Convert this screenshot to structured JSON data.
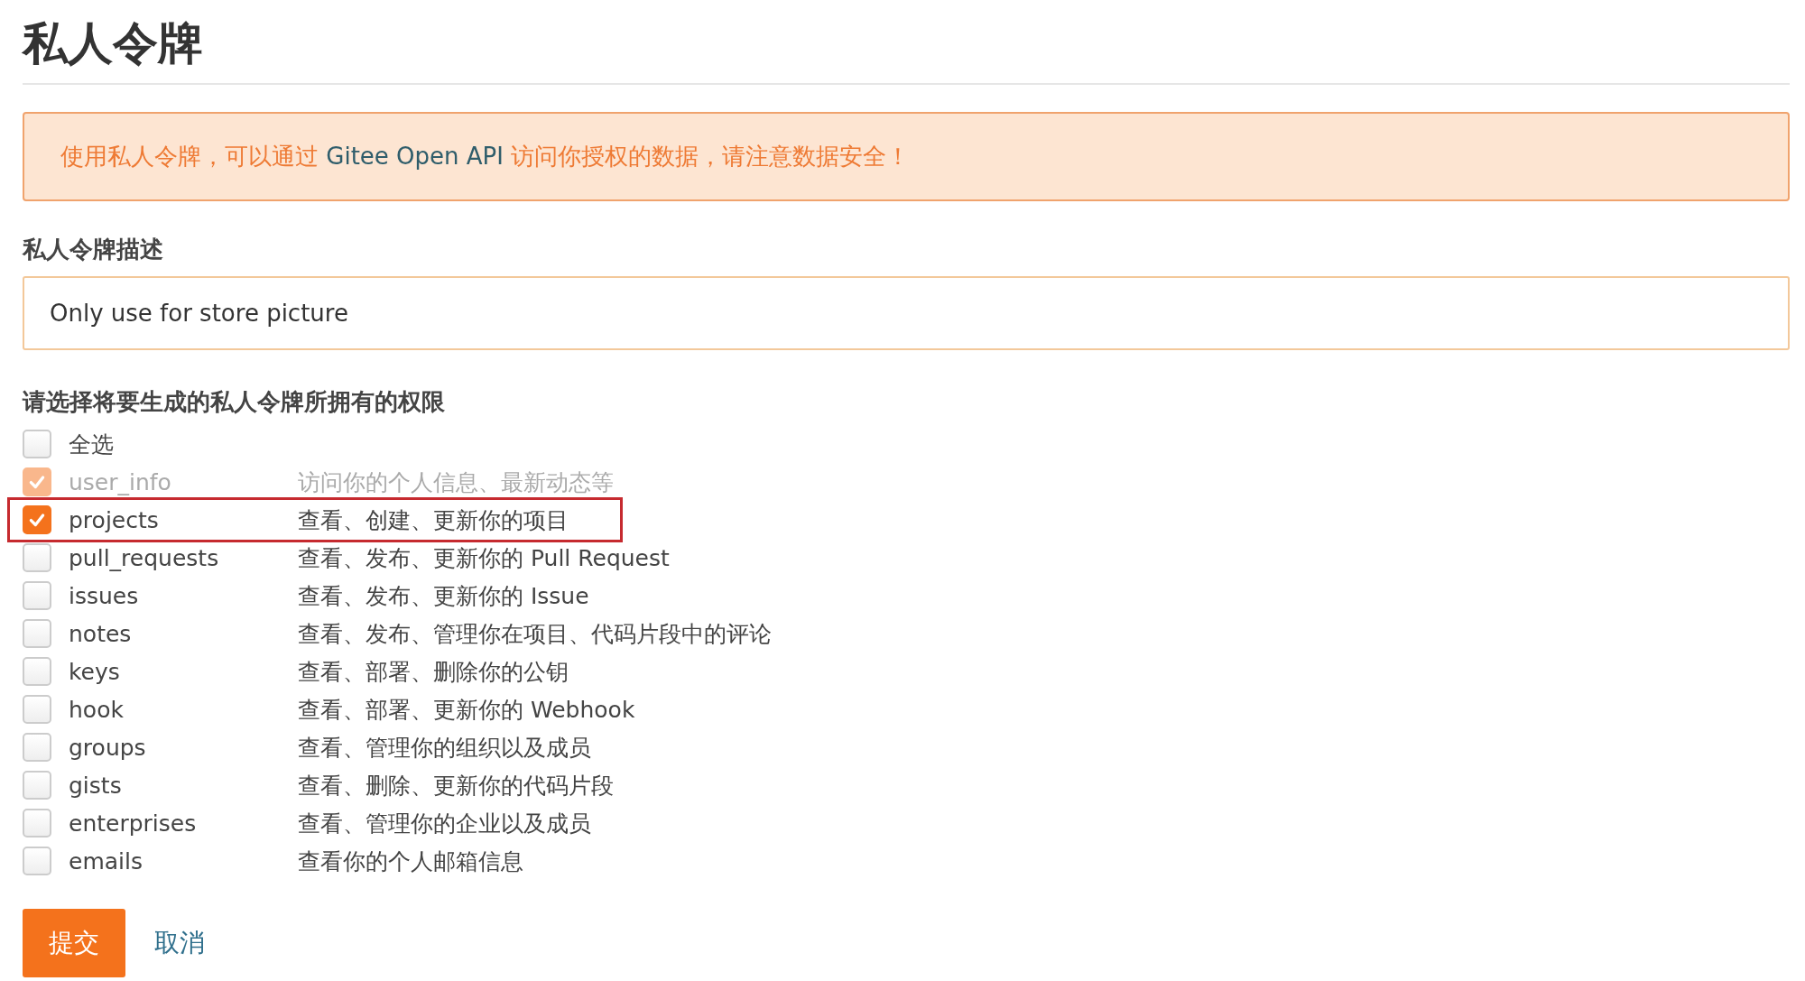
{
  "title": "私人令牌",
  "alert": {
    "segments": [
      {
        "kind": "plain",
        "text": "使用私人令牌，可以通过 "
      },
      {
        "kind": "term",
        "text": "Gitee Open API"
      },
      {
        "kind": "plain",
        "text": " 访问你授权的数据，请注意数据安全！"
      }
    ]
  },
  "description_field": {
    "label": "私人令牌描述",
    "value": "Only use for store picture"
  },
  "permissions": {
    "heading": "请选择将要生成的私人令牌所拥有的权限",
    "items": [
      {
        "name": "全选",
        "checked": false,
        "disabled": false,
        "highlighted": false
      },
      {
        "name": "user_info",
        "description": "访问你的个人信息、最新动态等",
        "checked": true,
        "disabled": true,
        "highlighted": false
      },
      {
        "name": "projects",
        "description": "查看、创建、更新你的项目",
        "checked": true,
        "disabled": false,
        "highlighted": true
      },
      {
        "name": "pull_requests",
        "description": "查看、发布、更新你的 Pull Request",
        "checked": false,
        "disabled": false,
        "highlighted": false
      },
      {
        "name": "issues",
        "description": "查看、发布、更新你的 Issue",
        "checked": false,
        "disabled": false,
        "highlighted": false
      },
      {
        "name": "notes",
        "description": "查看、发布、管理你在项目、代码片段中的评论",
        "checked": false,
        "disabled": false,
        "highlighted": false
      },
      {
        "name": "keys",
        "description": "查看、部署、删除你的公钥",
        "checked": false,
        "disabled": false,
        "highlighted": false
      },
      {
        "name": "hook",
        "description": "查看、部署、更新你的 Webhook",
        "checked": false,
        "disabled": false,
        "highlighted": false
      },
      {
        "name": "groups",
        "description": "查看、管理你的组织以及成员",
        "checked": false,
        "disabled": false,
        "highlighted": false
      },
      {
        "name": "gists",
        "description": "查看、删除、更新你的代码片段",
        "checked": false,
        "disabled": false,
        "highlighted": false
      },
      {
        "name": "enterprises",
        "description": "查看、管理你的企业以及成员",
        "checked": false,
        "disabled": false,
        "highlighted": false
      },
      {
        "name": "emails",
        "description": "查看你的个人邮箱信息",
        "checked": false,
        "disabled": false,
        "highlighted": false
      }
    ]
  },
  "buttons": {
    "submit": "提交",
    "cancel": "取消"
  }
}
